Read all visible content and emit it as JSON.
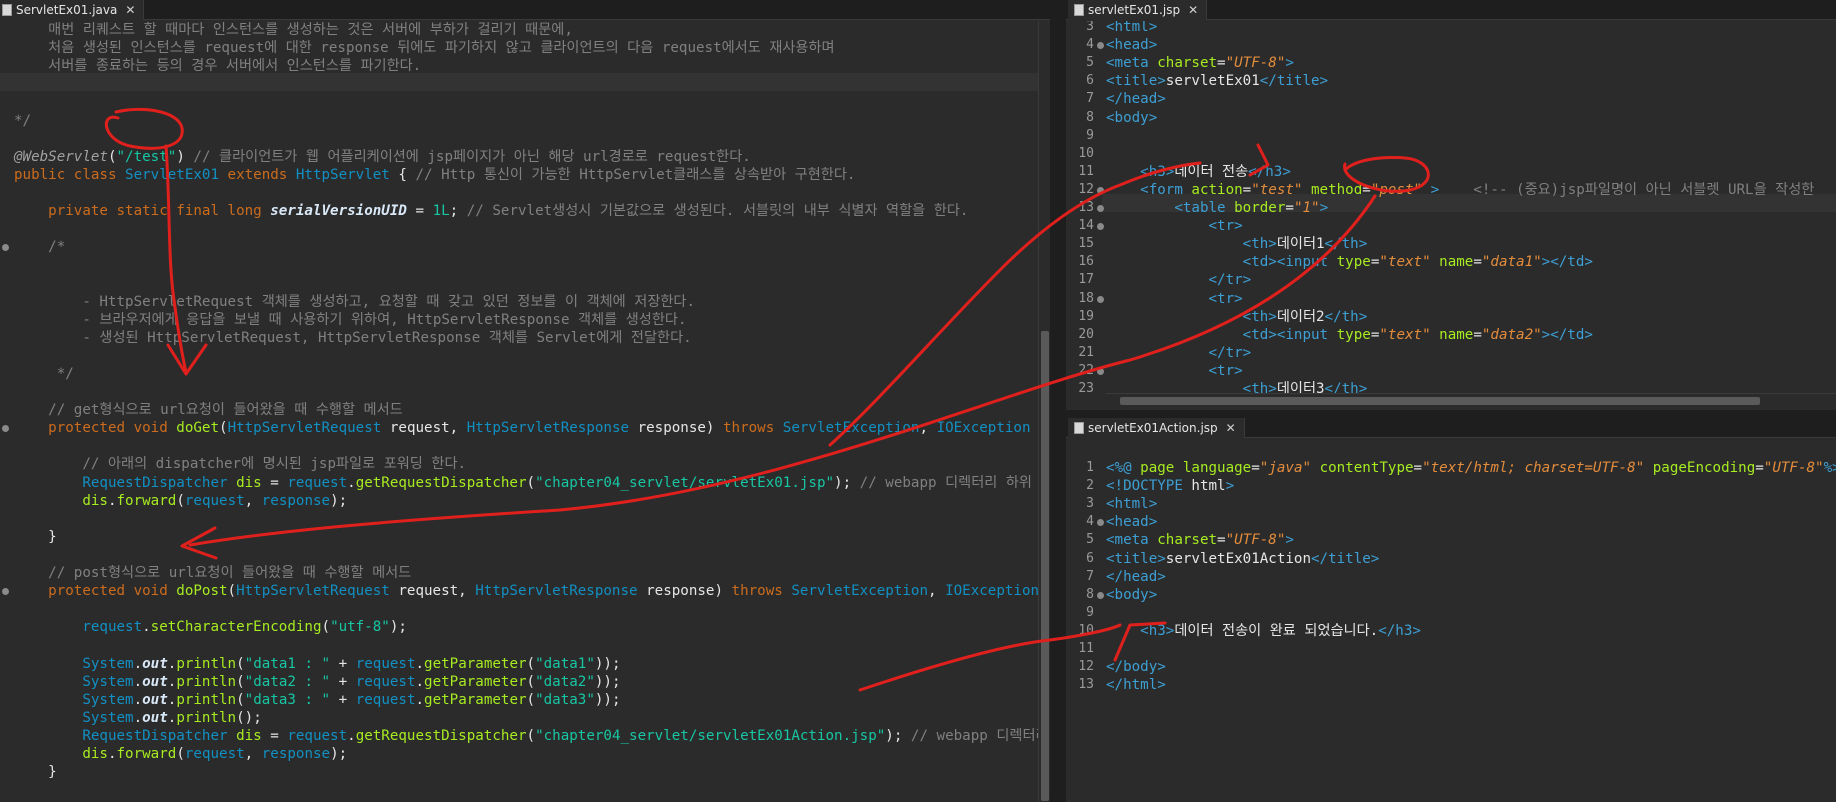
{
  "left_editor": {
    "tab_label": "ServletEx01.java",
    "lines": [
      [
        [
          "cm",
          "    매번 리퀘스트 할 때마다 인스턴스를 생성하는 것은 서버에 부하가 걸리기 때문에,"
        ]
      ],
      [
        [
          "cm",
          "    처음 생성된 인스턴스를 request에 대한 response 뒤에도 파기하지 않고 클라이언트의 다음 request에서도 재사용하며"
        ]
      ],
      [
        [
          "cm",
          "    서버를 종료하는 등의 경우 서버에서 인스턴스를 파기한다."
        ]
      ],
      [
        [
          "cm",
          ""
        ]
      ],
      [
        [
          "cm",
          ""
        ]
      ],
      [
        [
          "cm",
          "*/"
        ]
      ],
      [
        [
          "cm",
          ""
        ]
      ],
      [
        [
          "an",
          "@WebServlet"
        ],
        [
          "ds",
          "("
        ],
        [
          "st",
          "\"/test\""
        ],
        [
          "ds",
          ") "
        ],
        [
          "cm",
          "// 클라이언트가 웹 어플리케이션에 jsp페이지가 아닌 해당 url경로로 request한다."
        ]
      ],
      [
        [
          "kw",
          "public class "
        ],
        [
          "ty",
          "ServletEx01 "
        ],
        [
          "kw",
          "extends "
        ],
        [
          "ty",
          "HttpServlet "
        ],
        [
          "ds",
          "{ "
        ],
        [
          "cm",
          "// Http 통신이 가능한 HttpServlet클래스를 상속받아 구현한다."
        ]
      ],
      [
        [
          "ds",
          ""
        ]
      ],
      [
        [
          "ds",
          "    "
        ],
        [
          "kw",
          "private static final long "
        ],
        [
          "fl",
          "serialVersionUID"
        ],
        [
          "ds",
          " = "
        ],
        [
          "st",
          "1L"
        ],
        [
          "ds",
          "; "
        ],
        [
          "cm",
          "// Servlet생성시 기본값으로 생성된다. 서블릿의 내부 식별자 역할을 한다."
        ]
      ],
      [
        [
          "ds",
          ""
        ]
      ],
      [
        [
          "cm",
          "    /*"
        ]
      ],
      [
        [
          "ds",
          ""
        ]
      ],
      [
        [
          "ds",
          ""
        ]
      ],
      [
        [
          "cm",
          "        - HttpServletRequest 객체를 생성하고, 요청할 때 갖고 있던 정보를 이 객체에 저장한다."
        ]
      ],
      [
        [
          "cm",
          "        - 브라우저에게 응답을 보낼 때 사용하기 위하여, HttpServletResponse 객체를 생성한다."
        ]
      ],
      [
        [
          "cm",
          "        - 생성된 HttpServletRequest, HttpServletResponse 객체를 Servlet에게 전달한다."
        ]
      ],
      [
        [
          "ds",
          ""
        ]
      ],
      [
        [
          "cm",
          "     */"
        ]
      ],
      [
        [
          "ds",
          ""
        ]
      ],
      [
        [
          "cm",
          "    // get형식으로 url요청이 들어왔을 때 수행할 메서드"
        ]
      ],
      [
        [
          "ds",
          "    "
        ],
        [
          "kw",
          "protected void "
        ],
        [
          "mt",
          "doGet"
        ],
        [
          "ds",
          "("
        ],
        [
          "ty",
          "HttpServletRequest "
        ],
        [
          "ds",
          "request, "
        ],
        [
          "ty",
          "HttpServletResponse "
        ],
        [
          "ds",
          "response) "
        ],
        [
          "kw",
          "throws "
        ],
        [
          "ty",
          "ServletException"
        ],
        [
          "ds",
          ", "
        ],
        [
          "ty",
          "IOException "
        ],
        [
          "ds",
          "{"
        ]
      ],
      [
        [
          "ds",
          ""
        ]
      ],
      [
        [
          "cm",
          "        // 아래의 dispatcher에 명시된 jsp파일로 포워딩 한다."
        ]
      ],
      [
        [
          "ty",
          "        RequestDispatcher "
        ],
        [
          "mt",
          "dis"
        ],
        [
          "ds",
          " = "
        ],
        [
          "ty",
          "request"
        ],
        [
          "ds",
          "."
        ],
        [
          "mt",
          "getRequestDispatcher"
        ],
        [
          "ds",
          "("
        ],
        [
          "st",
          "\"chapter04_servlet/servletEx01.jsp\""
        ],
        [
          "ds",
          "); "
        ],
        [
          "cm",
          "// webapp 디렉터리 하위 경로"
        ]
      ],
      [
        [
          "ds",
          "        "
        ],
        [
          "mt",
          "dis"
        ],
        [
          "ds",
          "."
        ],
        [
          "mt",
          "forward"
        ],
        [
          "ds",
          "("
        ],
        [
          "ty",
          "request"
        ],
        [
          "ds",
          ", "
        ],
        [
          "ty",
          "response"
        ],
        [
          "ds",
          ");"
        ]
      ],
      [
        [
          "ds",
          ""
        ]
      ],
      [
        [
          "ds",
          "    }"
        ]
      ],
      [
        [
          "ds",
          ""
        ]
      ],
      [
        [
          "cm",
          "    // post형식으로 url요청이 들어왔을 때 수행할 메서드"
        ]
      ],
      [
        [
          "ds",
          "    "
        ],
        [
          "kw",
          "protected void "
        ],
        [
          "mt",
          "doPost"
        ],
        [
          "ds",
          "("
        ],
        [
          "ty",
          "HttpServletRequest "
        ],
        [
          "ds",
          "request, "
        ],
        [
          "ty",
          "HttpServletResponse "
        ],
        [
          "ds",
          "response) "
        ],
        [
          "kw",
          "throws "
        ],
        [
          "ty",
          "ServletException"
        ],
        [
          "ds",
          ", "
        ],
        [
          "ty",
          "IOException "
        ],
        [
          "ds",
          "{"
        ]
      ],
      [
        [
          "ds",
          ""
        ]
      ],
      [
        [
          "ty",
          "        request"
        ],
        [
          "ds",
          "."
        ],
        [
          "mt",
          "setCharacterEncoding"
        ],
        [
          "ds",
          "("
        ],
        [
          "st",
          "\"utf-8\""
        ],
        [
          "ds",
          ");"
        ]
      ],
      [
        [
          "ds",
          ""
        ]
      ],
      [
        [
          "ty",
          "        System"
        ],
        [
          "ds",
          "."
        ],
        [
          "fl",
          "out"
        ],
        [
          "ds",
          "."
        ],
        [
          "mt",
          "println"
        ],
        [
          "ds",
          "("
        ],
        [
          "st",
          "\"data1 : \""
        ],
        [
          "ds",
          " + "
        ],
        [
          "ty",
          "request"
        ],
        [
          "ds",
          "."
        ],
        [
          "mt",
          "getParameter"
        ],
        [
          "ds",
          "("
        ],
        [
          "st",
          "\"data1\""
        ],
        [
          "ds",
          "));"
        ]
      ],
      [
        [
          "ty",
          "        System"
        ],
        [
          "ds",
          "."
        ],
        [
          "fl",
          "out"
        ],
        [
          "ds",
          "."
        ],
        [
          "mt",
          "println"
        ],
        [
          "ds",
          "("
        ],
        [
          "st",
          "\"data2 : \""
        ],
        [
          "ds",
          " + "
        ],
        [
          "ty",
          "request"
        ],
        [
          "ds",
          "."
        ],
        [
          "mt",
          "getParameter"
        ],
        [
          "ds",
          "("
        ],
        [
          "st",
          "\"data2\""
        ],
        [
          "ds",
          "));"
        ]
      ],
      [
        [
          "ty",
          "        System"
        ],
        [
          "ds",
          "."
        ],
        [
          "fl",
          "out"
        ],
        [
          "ds",
          "."
        ],
        [
          "mt",
          "println"
        ],
        [
          "ds",
          "("
        ],
        [
          "st",
          "\"data3 : \""
        ],
        [
          "ds",
          " + "
        ],
        [
          "ty",
          "request"
        ],
        [
          "ds",
          "."
        ],
        [
          "mt",
          "getParameter"
        ],
        [
          "ds",
          "("
        ],
        [
          "st",
          "\"data3\""
        ],
        [
          "ds",
          "));"
        ]
      ],
      [
        [
          "ty",
          "        System"
        ],
        [
          "ds",
          "."
        ],
        [
          "fl",
          "out"
        ],
        [
          "ds",
          "."
        ],
        [
          "mt",
          "println"
        ],
        [
          "ds",
          "();"
        ]
      ],
      [
        [
          "ty",
          "        RequestDispatcher "
        ],
        [
          "mt",
          "dis"
        ],
        [
          "ds",
          " = "
        ],
        [
          "ty",
          "request"
        ],
        [
          "ds",
          "."
        ],
        [
          "mt",
          "getRequestDispatcher"
        ],
        [
          "ds",
          "("
        ],
        [
          "st",
          "\"chapter04_servlet/servletEx01Action.jsp\""
        ],
        [
          "ds",
          "); "
        ],
        [
          "cm",
          "// webapp 디렉터리 하위"
        ]
      ],
      [
        [
          "ds",
          "        "
        ],
        [
          "mt",
          "dis"
        ],
        [
          "ds",
          "."
        ],
        [
          "mt",
          "forward"
        ],
        [
          "ds",
          "("
        ],
        [
          "ty",
          "request"
        ],
        [
          "ds",
          ", "
        ],
        [
          "ty",
          "response"
        ],
        [
          "ds",
          ");"
        ]
      ],
      [
        [
          "ds",
          "    }"
        ]
      ],
      [
        [
          "ds",
          ""
        ]
      ],
      [
        [
          "ds",
          ""
        ]
      ],
      [
        [
          "ds",
          "}"
        ]
      ]
    ],
    "folds": [
      12,
      22,
      31
    ]
  },
  "right_top_editor": {
    "tab_label": "servletEx01.jsp",
    "line_numbers": [
      "3",
      "4",
      "5",
      "6",
      "7",
      "8",
      "9",
      "10",
      "11",
      "12",
      "13",
      "14",
      "15",
      "16",
      "17",
      "18",
      "19",
      "20",
      "21",
      "22",
      "23"
    ],
    "lines": [
      [
        [
          "tg",
          "<html>"
        ]
      ],
      [
        [
          "tg",
          "<head>"
        ]
      ],
      [
        [
          "tg",
          "<meta "
        ],
        [
          "at",
          "charset"
        ],
        [
          "ds",
          "="
        ],
        [
          "av",
          "\"UTF-8\""
        ],
        [
          "tg",
          ">"
        ]
      ],
      [
        [
          "tg",
          "<title>"
        ],
        [
          "ds",
          "servletEx01"
        ],
        [
          "tg",
          "</title>"
        ]
      ],
      [
        [
          "tg",
          "</head>"
        ]
      ],
      [
        [
          "tg",
          "<body>"
        ]
      ],
      [
        [
          "ds",
          ""
        ]
      ],
      [
        [
          "ds",
          ""
        ]
      ],
      [
        [
          "ds",
          "    "
        ],
        [
          "tg",
          "<h3>"
        ],
        [
          "ds",
          "데이터 전송"
        ],
        [
          "tg",
          "</h3>"
        ]
      ],
      [
        [
          "ds",
          "    "
        ],
        [
          "tg",
          "<form "
        ],
        [
          "at",
          "action"
        ],
        [
          "ds",
          "="
        ],
        [
          "av",
          "\"test\""
        ],
        [
          "ds",
          " "
        ],
        [
          "at",
          "method"
        ],
        [
          "ds",
          "="
        ],
        [
          "av",
          "\"post\""
        ],
        [
          "ds",
          " "
        ],
        [
          "tg",
          ">"
        ],
        [
          "cm",
          "    <!-- (중요)jsp파일명이 아닌 서블렛 URL을 작성한"
        ]
      ],
      [
        [
          "ds",
          "        "
        ],
        [
          "tg",
          "<table "
        ],
        [
          "at",
          "border"
        ],
        [
          "ds",
          "="
        ],
        [
          "av",
          "\"1\""
        ],
        [
          "tg",
          ">"
        ]
      ],
      [
        [
          "ds",
          "            "
        ],
        [
          "tg",
          "<tr>"
        ]
      ],
      [
        [
          "ds",
          "                "
        ],
        [
          "tg",
          "<th>"
        ],
        [
          "ds",
          "데이터1"
        ],
        [
          "tg",
          "</th>"
        ]
      ],
      [
        [
          "ds",
          "                "
        ],
        [
          "tg",
          "<td><input "
        ],
        [
          "at",
          "type"
        ],
        [
          "ds",
          "="
        ],
        [
          "av",
          "\"text\""
        ],
        [
          "ds",
          " "
        ],
        [
          "at",
          "name"
        ],
        [
          "ds",
          "="
        ],
        [
          "av",
          "\"data1\""
        ],
        [
          "tg",
          "></td>"
        ]
      ],
      [
        [
          "ds",
          "            "
        ],
        [
          "tg",
          "</tr>"
        ]
      ],
      [
        [
          "ds",
          "            "
        ],
        [
          "tg",
          "<tr>"
        ]
      ],
      [
        [
          "ds",
          "                "
        ],
        [
          "tg",
          "<th>"
        ],
        [
          "ds",
          "데이터2"
        ],
        [
          "tg",
          "</th>"
        ]
      ],
      [
        [
          "ds",
          "                "
        ],
        [
          "tg",
          "<td><input "
        ],
        [
          "at",
          "type"
        ],
        [
          "ds",
          "="
        ],
        [
          "av",
          "\"text\""
        ],
        [
          "ds",
          " "
        ],
        [
          "at",
          "name"
        ],
        [
          "ds",
          "="
        ],
        [
          "av",
          "\"data2\""
        ],
        [
          "tg",
          "></td>"
        ]
      ],
      [
        [
          "ds",
          "            "
        ],
        [
          "tg",
          "</tr>"
        ]
      ],
      [
        [
          "ds",
          "            "
        ],
        [
          "tg",
          "<tr>"
        ]
      ],
      [
        [
          "ds",
          "                "
        ],
        [
          "tg",
          "<th>"
        ],
        [
          "ds",
          "데이터3"
        ],
        [
          "tg",
          "</th>"
        ]
      ]
    ],
    "folds": [
      1,
      9,
      10,
      11,
      15,
      19
    ]
  },
  "right_bottom_editor": {
    "tab_label": "servletEx01Action.jsp",
    "line_numbers": [
      "1",
      "2",
      "3",
      "4",
      "5",
      "6",
      "7",
      "8",
      "9",
      "10",
      "11",
      "12",
      "13"
    ],
    "lines": [
      [
        [
          "tg",
          "<%@ "
        ],
        [
          "at",
          "page "
        ],
        [
          "at",
          "language"
        ],
        [
          "ds",
          "="
        ],
        [
          "av",
          "\"java\""
        ],
        [
          "ds",
          " "
        ],
        [
          "at",
          "contentType"
        ],
        [
          "ds",
          "="
        ],
        [
          "av",
          "\"text/html; charset=UTF-8\""
        ],
        [
          "ds",
          " "
        ],
        [
          "at",
          "pageEncoding"
        ],
        [
          "ds",
          "="
        ],
        [
          "av",
          "\"UTF-8\""
        ],
        [
          "tg",
          "%>"
        ]
      ],
      [
        [
          "tg",
          "<!DOCTYPE "
        ],
        [
          "ds",
          "html"
        ],
        [
          "tg",
          ">"
        ]
      ],
      [
        [
          "tg",
          "<html>"
        ]
      ],
      [
        [
          "tg",
          "<head>"
        ]
      ],
      [
        [
          "tg",
          "<meta "
        ],
        [
          "at",
          "charset"
        ],
        [
          "ds",
          "="
        ],
        [
          "av",
          "\"UTF-8\""
        ],
        [
          "tg",
          ">"
        ]
      ],
      [
        [
          "tg",
          "<title>"
        ],
        [
          "ds",
          "servletEx01Action"
        ],
        [
          "tg",
          "</title>"
        ]
      ],
      [
        [
          "tg",
          "</head>"
        ]
      ],
      [
        [
          "tg",
          "<body>"
        ]
      ],
      [
        [
          "ds",
          ""
        ]
      ],
      [
        [
          "ds",
          "    "
        ],
        [
          "tg",
          "<h3>"
        ],
        [
          "ds",
          "데이터 전송이 완료 되었습니다."
        ],
        [
          "tg",
          "</h3>"
        ]
      ],
      [
        [
          "ds",
          ""
        ]
      ],
      [
        [
          "tg",
          "</body>"
        ]
      ],
      [
        [
          "tg",
          "</html>"
        ]
      ]
    ],
    "folds": [
      3,
      7
    ]
  },
  "colors": {
    "editor_bg": "#2b2b2b",
    "annotation_red": "#e0201c"
  }
}
